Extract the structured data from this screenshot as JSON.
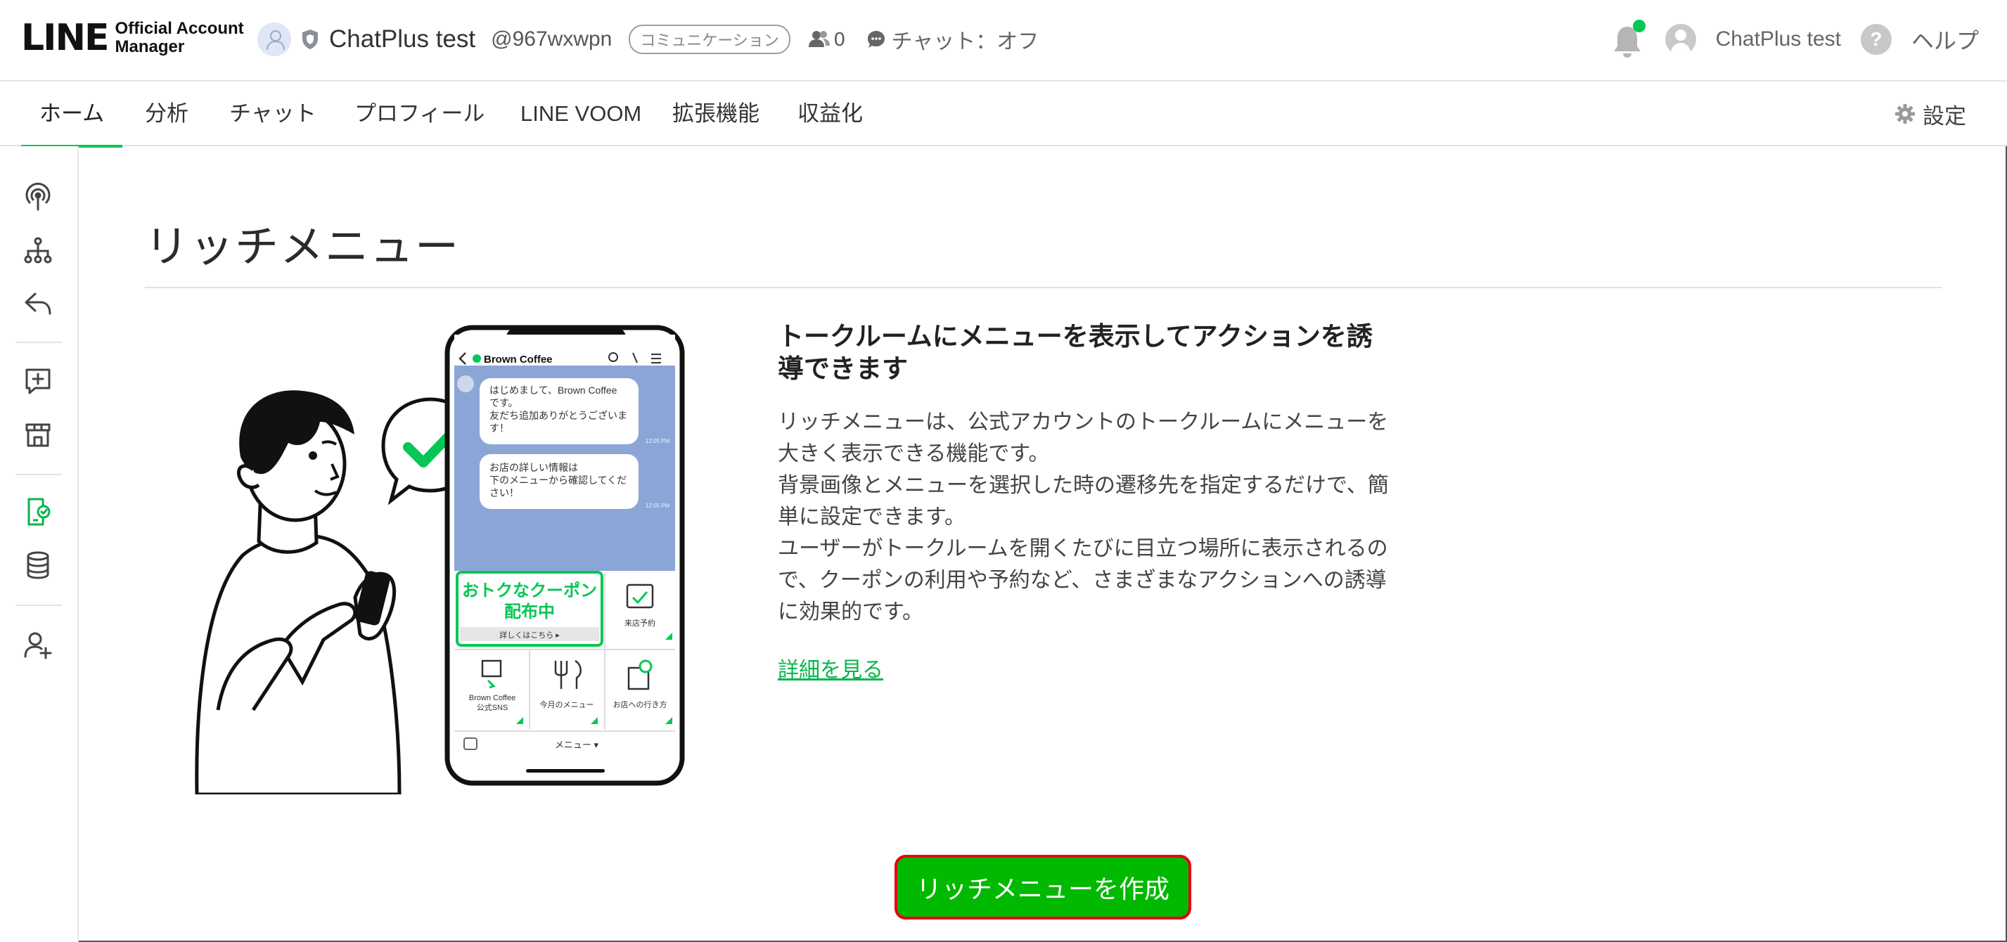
{
  "brand": {
    "logo_text": "LINE",
    "logo_sub_line1": "Official Account",
    "logo_sub_line2": "Manager",
    "accent_color": "#06c755"
  },
  "account": {
    "name": "ChatPlus test",
    "id": "@967wxwpn",
    "plan_badge": "コミュニケーション",
    "friends_count": "0",
    "chat_status": "チャット：オフ"
  },
  "header_right": {
    "user_name": "ChatPlus test",
    "help_label": "ヘルプ",
    "notification_dot": true
  },
  "tabs": [
    {
      "label": "ホーム",
      "active": true
    },
    {
      "label": "分析",
      "active": false
    },
    {
      "label": "チャット",
      "active": false
    },
    {
      "label": "プロフィール",
      "active": false
    },
    {
      "label": "LINE VOOM",
      "active": false
    },
    {
      "label": "拡張機能",
      "active": false
    },
    {
      "label": "収益化",
      "active": false
    }
  ],
  "settings_label": "設定",
  "sidebar": [
    {
      "icon": "broadcast-icon",
      "active": false
    },
    {
      "icon": "org-tree-icon",
      "active": false
    },
    {
      "icon": "reply-icon",
      "active": false
    },
    {
      "icon": "add-message-icon",
      "active": false
    },
    {
      "icon": "shop-icon",
      "active": false
    },
    {
      "icon": "rich-menu-icon",
      "active": true
    },
    {
      "icon": "database-icon",
      "active": false
    },
    {
      "icon": "add-user-icon",
      "active": false
    }
  ],
  "page": {
    "title": "リッチメニュー",
    "headline": "トークルームにメニューを表示してアクションを誘導できます",
    "description": [
      "リッチメニューは、公式アカウントのトークルームにメニューを大きく表示できる機能です。",
      "背景画像とメニューを選択した時の遷移先を指定するだけで、簡単に設定できます。",
      "ユーザーがトークルームを開くたびに目立つ場所に表示されるので、クーポンの利用や予約など、さまざまなアクションへの誘導に効果的です。"
    ],
    "more_link": "詳細を見る",
    "create_button": "リッチメニューを作成"
  },
  "phone_mock": {
    "chat_title": "Brown Coffee",
    "bubble1": [
      "はじめまして、Brown Coffee",
      "です。",
      "友だち追加ありがとうございま",
      "す！"
    ],
    "bubble2": [
      "お店の詳しい情報は",
      "下のメニューから確認してくだ",
      "さい！"
    ],
    "time": "12:05 PM",
    "coupon_line1": "おトクなクーポン",
    "coupon_line2": "配布中",
    "coupon_sub": "詳しくはこちら ▸",
    "cell_reserve": "来店予約",
    "cell_sns_line1": "Brown Coffee",
    "cell_sns_line2": "公式SNS",
    "cell_menu": "今月のメニュー",
    "cell_access": "お店への行き方",
    "menu_bar": "メニュー ▾"
  }
}
